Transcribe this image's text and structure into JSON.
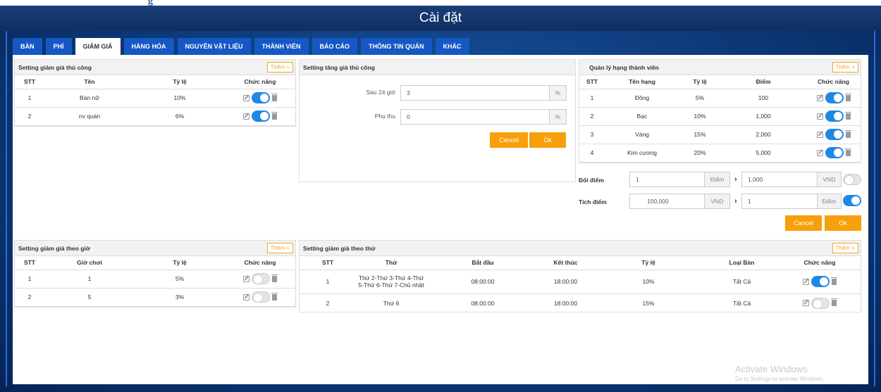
{
  "window": {
    "title": "Cài đặt",
    "header_fragment": "g"
  },
  "tabs": [
    "BÀN",
    "PHÍ",
    "GIẢM GIÁ",
    "HÀNG HÓA",
    "NGUYÊN VẬT LIỆU",
    "THÀNH VIÊN",
    "BÁO CÁO",
    "THÔNG TIN QUÁN",
    "KHÁC"
  ],
  "active_tab": "GIẢM GIÁ",
  "manual_discount": {
    "title": "Setting giảm giá thủ công",
    "add_label": "Thêm +",
    "headers": [
      "STT",
      "Tên",
      "Tỷ lệ",
      "Chức năng"
    ],
    "rows": [
      {
        "stt": "1",
        "name": "Bán nữ",
        "rate": "10%",
        "enabled": true
      },
      {
        "stt": "2",
        "name": "nv quán",
        "rate": "6%",
        "enabled": true
      }
    ]
  },
  "manual_increase": {
    "title": "Setting tăng giá thủ công",
    "after24_label": "Sau 24 giờ",
    "after24_value": "3",
    "surcharge_label": "Phụ thu",
    "surcharge_value": "0",
    "unit": "%",
    "cancel_label": "Cancel",
    "ok_label": "Ok"
  },
  "membership": {
    "title": "Quản lý hạng thành viên",
    "add_label": "Thêm +",
    "headers": [
      "STT",
      "Tên hạng",
      "Tỷ lệ",
      "Điểm",
      "Chức năng"
    ],
    "rows": [
      {
        "stt": "1",
        "name": "Đồng",
        "rate": "5%",
        "points": "100",
        "enabled": true
      },
      {
        "stt": "2",
        "name": "Bạc",
        "rate": "10%",
        "points": "1,000",
        "enabled": true
      },
      {
        "stt": "3",
        "name": "Vàng",
        "rate": "15%",
        "points": "2,000",
        "enabled": true
      },
      {
        "stt": "4",
        "name": "Kim cương",
        "rate": "20%",
        "points": "5,000",
        "enabled": true
      }
    ],
    "exchange": {
      "label": "Đổi điểm",
      "value1": "1",
      "unit1": "Điểm",
      "value2": "1,000",
      "unit2": "VND",
      "enabled": false
    },
    "accumulate": {
      "label": "Tích điểm",
      "value1": "100,000",
      "unit1": "VND",
      "value2": "1",
      "unit2": "Điểm",
      "enabled": true
    },
    "cancel_label": "Cancel",
    "ok_label": "Ok"
  },
  "hourly_discount": {
    "title": "Setting giảm giá theo giờ",
    "add_label": "Thêm +",
    "headers": [
      "STT",
      "Giờ chơi",
      "Tỷ lệ",
      "Chức năng"
    ],
    "rows": [
      {
        "stt": "1",
        "hours": "1",
        "rate": "5%",
        "enabled": false
      },
      {
        "stt": "2",
        "hours": "5",
        "rate": "3%",
        "enabled": false
      }
    ]
  },
  "weekday_discount": {
    "title": "Setting giảm giá theo thứ",
    "add_label": "Thêm +",
    "headers": [
      "STT",
      "Thứ",
      "Bắt đầu",
      "Kết thúc",
      "Tỷ lệ",
      "Loại Bàn",
      "Chức năng"
    ],
    "rows": [
      {
        "stt": "1",
        "days": "Thứ 2-Thứ 3-Thứ 4-Thứ 5-Thứ 6-Thứ 7-Chủ nhật",
        "start": "08:00:00",
        "end": "18:00:00",
        "rate": "10%",
        "table_type": "Tất Cả",
        "enabled": true
      },
      {
        "stt": "2",
        "days": "Thứ 6",
        "start": "08:00:00",
        "end": "18:00:00",
        "rate": "15%",
        "table_type": "Tất Cả",
        "enabled": false
      }
    ]
  },
  "watermark": {
    "line1": "Activate Windows",
    "line2": "Go to Settings to activate Windows."
  }
}
